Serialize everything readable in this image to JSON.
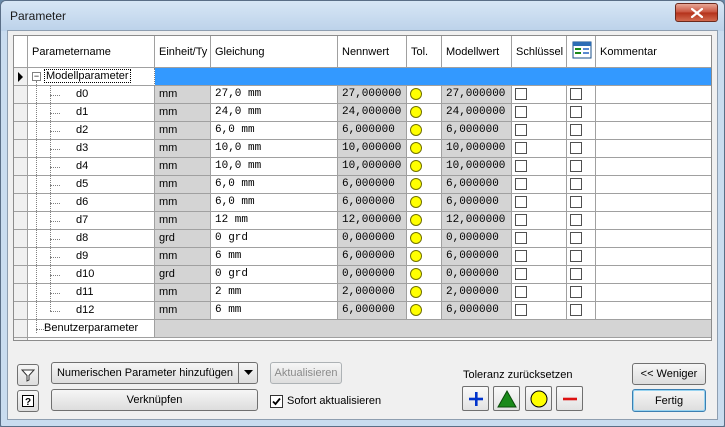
{
  "window": {
    "title": "Parameter"
  },
  "columns": [
    "Parametername",
    "Einheit/Ty",
    "Gleichung",
    "Nennwert",
    "Tol.",
    "Modellwert",
    "Schlüssel",
    "",
    "Kommentar"
  ],
  "groups": {
    "model": "Modellparameter",
    "user": "Benutzerparameter"
  },
  "rows": [
    {
      "name": "d0",
      "unit": "mm",
      "equation": "27,0 mm",
      "nominal": "27,000000",
      "model": "27,000000"
    },
    {
      "name": "d1",
      "unit": "mm",
      "equation": "24,0 mm",
      "nominal": "24,000000",
      "model": "24,000000"
    },
    {
      "name": "d2",
      "unit": "mm",
      "equation": "6,0 mm",
      "nominal": "6,000000",
      "model": "6,000000"
    },
    {
      "name": "d3",
      "unit": "mm",
      "equation": "10,0 mm",
      "nominal": "10,000000",
      "model": "10,000000"
    },
    {
      "name": "d4",
      "unit": "mm",
      "equation": "10,0 mm",
      "nominal": "10,000000",
      "model": "10,000000"
    },
    {
      "name": "d5",
      "unit": "mm",
      "equation": "6,0 mm",
      "nominal": "6,000000",
      "model": "6,000000"
    },
    {
      "name": "d6",
      "unit": "mm",
      "equation": "6,0 mm",
      "nominal": "6,000000",
      "model": "6,000000"
    },
    {
      "name": "d7",
      "unit": "mm",
      "equation": "12 mm",
      "nominal": "12,000000",
      "model": "12,000000"
    },
    {
      "name": "d8",
      "unit": "grd",
      "equation": "0 grd",
      "nominal": "0,000000",
      "model": "0,000000"
    },
    {
      "name": "d9",
      "unit": "mm",
      "equation": "6 mm",
      "nominal": "6,000000",
      "model": "6,000000"
    },
    {
      "name": "d10",
      "unit": "grd",
      "equation": "0 grd",
      "nominal": "0,000000",
      "model": "0,000000"
    },
    {
      "name": "d11",
      "unit": "mm",
      "equation": "2 mm",
      "nominal": "2,000000",
      "model": "2,000000"
    },
    {
      "name": "d12",
      "unit": "mm",
      "equation": "6 mm",
      "nominal": "6,000000",
      "model": "6,000000"
    }
  ],
  "toolbar": {
    "add_numeric": "Numerischen Parameter hinzufügen",
    "update": "Aktualisieren",
    "link": "Verknüpfen",
    "immediate_update": "Sofort aktualisieren",
    "less": "<< Weniger",
    "done": "Fertig",
    "tolerance_reset": "Toleranz zurücksetzen"
  },
  "icons": {
    "filter": "filter-icon",
    "help": "help-icon",
    "tol_upper": "plus-icon",
    "tol_median": "triangle-icon",
    "tol_nominal": "circle-icon",
    "tol_lower": "minus-icon"
  },
  "colors": {
    "selection": "#3399ff",
    "tolerance_circle": "#ffff00",
    "plus": "#0033cc",
    "triangle": "#1a8a1a",
    "minus": "#dd1111"
  },
  "state": {
    "immediate_update_checked": true
  }
}
